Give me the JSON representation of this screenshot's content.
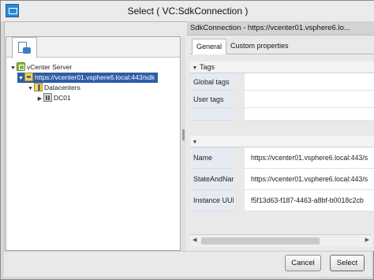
{
  "window": {
    "title": "Select ( VC:SdkConnection  )"
  },
  "tree": {
    "items": [
      {
        "label": "vCenter Server",
        "icon": "vcenter-icon",
        "expanded": true
      },
      {
        "label": "https://vcenter01.vsphere6.local:443/sdk",
        "icon": "sdk-connection-icon",
        "expanded": true,
        "selected": true
      },
      {
        "label": "Datacenters",
        "icon": "datacenters-folder-icon",
        "expanded": true
      },
      {
        "label": "DC01",
        "icon": "datacenter-icon",
        "expanded": false
      }
    ]
  },
  "details": {
    "header": "SdkConnection - https://vcenter01.vsphere6.lo...",
    "tabs": [
      "General",
      "Custom properties"
    ],
    "tags_group": {
      "title": "Tags",
      "rows": [
        {
          "label": "Global tags",
          "value": ""
        },
        {
          "label": "User tags",
          "value": ""
        }
      ]
    },
    "properties": [
      {
        "label": "Name",
        "value": "https://vcenter01.vsphere6.local:443/s"
      },
      {
        "label": "StateAndName",
        "value": "https://vcenter01.vsphere6.local:443/s"
      },
      {
        "label": "Instance UUID",
        "value": "f5f13d63-f187-4463-a8bf-b0018c2cb"
      }
    ]
  },
  "buttons": {
    "cancel": "Cancel",
    "select": "Select"
  }
}
